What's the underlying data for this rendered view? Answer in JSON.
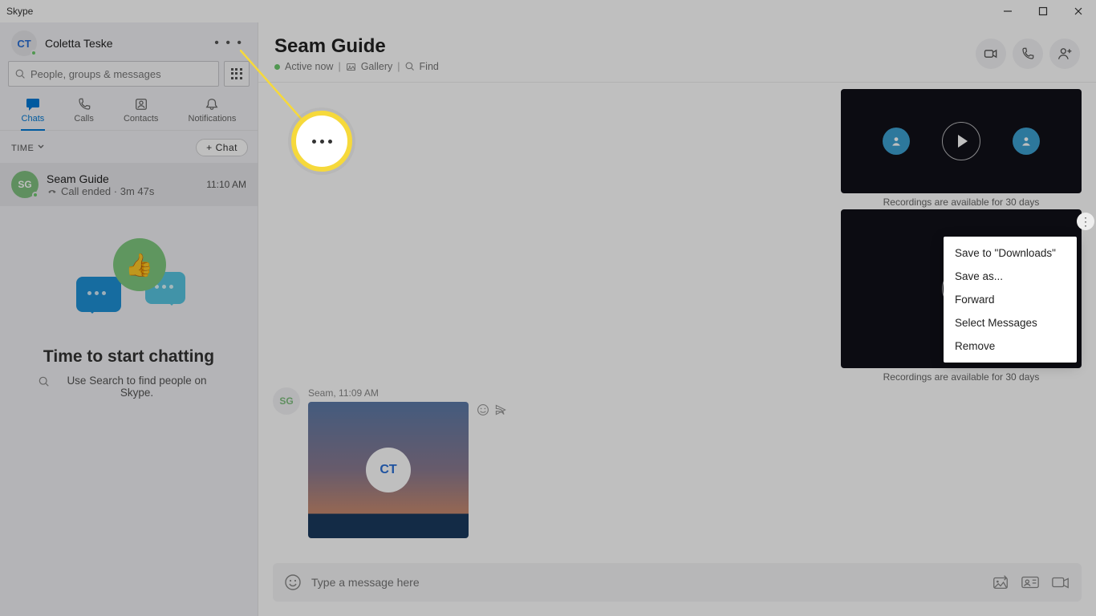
{
  "app": {
    "title": "Skype"
  },
  "window": {
    "minimize": "—",
    "maximize": "▢",
    "close": "✕"
  },
  "profile": {
    "initials": "CT",
    "name": "Coletta Teske"
  },
  "search": {
    "placeholder": "People, groups & messages"
  },
  "tabs": [
    {
      "label": "Chats"
    },
    {
      "label": "Calls"
    },
    {
      "label": "Contacts"
    },
    {
      "label": "Notifications"
    }
  ],
  "filter": {
    "label": "TIME"
  },
  "new_chat_btn": "Chat",
  "conversation_item": {
    "initials": "SG",
    "title": "Seam Guide",
    "subtitle": "Call ended · 3m 47s",
    "time": "11:10 AM"
  },
  "empty": {
    "title": "Time to start chatting",
    "subtitle": "Use Search to find people on Skype."
  },
  "conv_header": {
    "title": "Seam Guide",
    "status": "Active now",
    "gallery": "Gallery",
    "find": "Find"
  },
  "recordings_caption": "Recordings are available for 30 days",
  "context_menu": [
    "Save to \"Downloads\"",
    "Save as...",
    "Forward",
    "Select Messages",
    "Remove"
  ],
  "message": {
    "sender": "Seam",
    "time": "11:09 AM",
    "avatar_initials": "SG",
    "badge": "CT"
  },
  "composer": {
    "placeholder": "Type a message here"
  }
}
